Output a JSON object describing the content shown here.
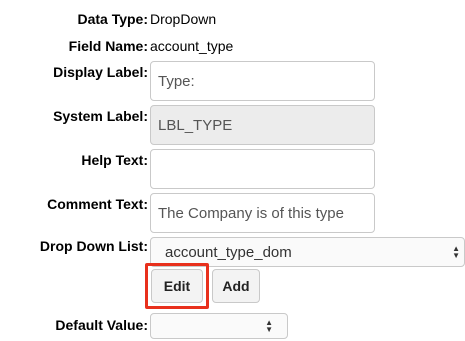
{
  "fields": {
    "data_type": {
      "label": "Data Type:",
      "value": "DropDown"
    },
    "field_name": {
      "label": "Field Name:",
      "value": "account_type"
    },
    "display_label": {
      "label": "Display Label:",
      "value": "Type:"
    },
    "system_label": {
      "label": "System Label:",
      "value": "LBL_TYPE"
    },
    "help_text": {
      "label": "Help Text:",
      "value": ""
    },
    "comment_text": {
      "label": "Comment Text:",
      "value": "The Company is of this type"
    },
    "drop_down_list": {
      "label": "Drop Down List:",
      "value": "account_type_dom"
    },
    "default_value": {
      "label": "Default Value:",
      "value": ""
    }
  },
  "buttons": {
    "edit": "Edit",
    "add": "Add"
  },
  "colors": {
    "highlight": "#e8301c",
    "readonly_bg": "#ececec"
  },
  "icons": {
    "select_arrows": "up-down-chevron-icon"
  }
}
